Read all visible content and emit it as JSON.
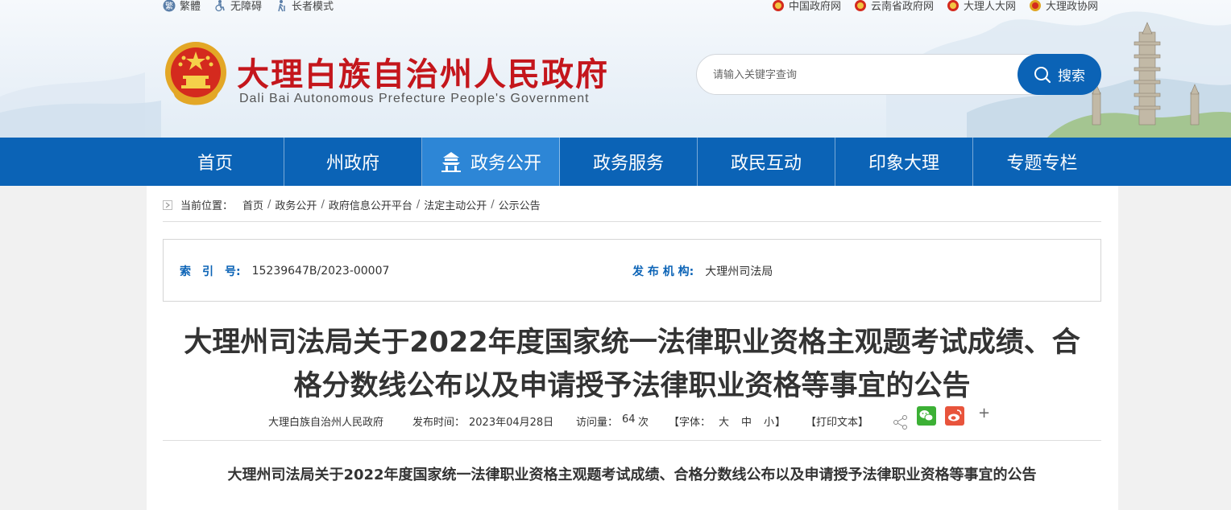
{
  "topbar": {
    "left": [
      {
        "label": "繁體",
        "icon": "traditional-chinese-icon"
      },
      {
        "label": "无障碍",
        "icon": "accessibility-icon"
      },
      {
        "label": "长者模式",
        "icon": "elder-mode-icon"
      }
    ],
    "right": [
      {
        "label": "中国政府网",
        "icon": "national-emblem-icon"
      },
      {
        "label": "云南省政府网",
        "icon": "national-emblem-icon"
      },
      {
        "label": "大理人大网",
        "icon": "national-emblem-icon"
      },
      {
        "label": "大理政协网",
        "icon": "cppcc-emblem-icon"
      }
    ]
  },
  "header": {
    "title_cn": "大理白族自治州人民政府",
    "title_en": "Dali Bai Autonomous Prefecture People's Government",
    "brand_color": "#c4161c"
  },
  "search": {
    "placeholder": "请输入关键字查询",
    "button_label": "搜索",
    "accent": "#0b63b6"
  },
  "nav": {
    "items": [
      {
        "label": "首页"
      },
      {
        "label": "州政府"
      },
      {
        "label": "政务公开",
        "active": true,
        "icon": "pavilion-icon"
      },
      {
        "label": "政务服务"
      },
      {
        "label": "政民互动"
      },
      {
        "label": "印象大理"
      },
      {
        "label": "专题专栏"
      }
    ]
  },
  "breadcrumb": {
    "label": "当前位置：",
    "items": [
      "首页",
      "政务公开",
      "政府信息公开平台",
      "法定主动公开",
      "公示公告"
    ]
  },
  "meta": {
    "index_key": "索　引　号:",
    "index_value": "15239647B/2023-00007",
    "org_key": "发 布 机 构:",
    "org_value": "大理州司法局"
  },
  "article": {
    "title_line1": "大理州司法局关于2022年度国家统一法律职业资格主观题考试成绩、合",
    "title_line2": "格分数线公布以及申请授予法律职业资格等事宜的公告",
    "source": "大理白族自治州人民政府",
    "publish_label": "发布时间：",
    "publish_date": "2023年04月28日",
    "views_label": "访问量：",
    "views": "64",
    "views_unit": "次",
    "font_label": "【字体：",
    "font_large": "大",
    "font_medium": "中",
    "font_small": "小",
    "font_end": "】",
    "print_label": "【打印文本】",
    "more": "+",
    "subtitle": "大理州司法局关于2022年度国家统一法律职业资格主观题考试成绩、合格分数线公布以及申请授予法律职业资格等事宜的公告"
  }
}
